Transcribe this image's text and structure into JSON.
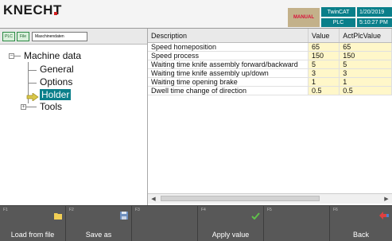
{
  "header": {
    "logo": "KNECHT",
    "mode": "MANUAL",
    "twincat": "TwinCAT",
    "plc": "PLC",
    "date": "1/20/2019",
    "time": "5:10:27 PM"
  },
  "toolbar": {
    "plc_label": "PLC",
    "file_label": "File",
    "title": "Maschinendaten"
  },
  "tree": {
    "root": "Machine data",
    "items": [
      "General",
      "Options",
      "Holder",
      "Tools"
    ],
    "selected": "Holder"
  },
  "table": {
    "headers": [
      "Description",
      "Value",
      "ActPlcValue"
    ],
    "rows": [
      [
        "Speed homeposition",
        "65",
        "65"
      ],
      [
        "Speed process",
        "150",
        "150"
      ],
      [
        "Waiting time knife assembly forward/backward",
        "5",
        "5"
      ],
      [
        "Waiting time knife assembly up/down",
        "3",
        "3"
      ],
      [
        "Waiting time opening brake",
        "1",
        "1"
      ],
      [
        "Dwell time change of direction",
        "0.5",
        "0.5"
      ]
    ]
  },
  "fkeys": [
    {
      "num": "F1",
      "label": "Load from file",
      "icon": "folder-icon"
    },
    {
      "num": "F2",
      "label": "Save as",
      "icon": "save-disk-icon"
    },
    {
      "num": "F3",
      "label": "",
      "icon": ""
    },
    {
      "num": "F4",
      "label": "Apply value",
      "icon": "checkmark-icon"
    },
    {
      "num": "F5",
      "label": "",
      "icon": ""
    },
    {
      "num": "F6",
      "label": "Back",
      "icon": "back-arrow-icon"
    }
  ],
  "colors": {
    "accent": "#0a7f8a",
    "value_cell": "#fff7c9",
    "fkey_bar": "#585858",
    "mode_bg": "#c3b18a"
  }
}
